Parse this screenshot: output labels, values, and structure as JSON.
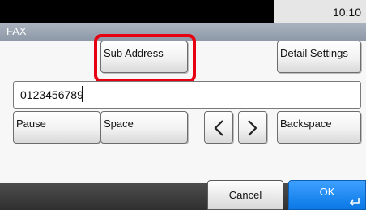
{
  "status": {
    "time": "10:10"
  },
  "header": {
    "title": "FAX"
  },
  "buttons": {
    "sub_address": "Sub Address",
    "detail_settings": "Detail Settings",
    "pause": "Pause",
    "space": "Space",
    "backspace": "Backspace"
  },
  "input": {
    "value": "0123456789"
  },
  "footer": {
    "cancel": "Cancel",
    "ok": "OK"
  },
  "colors": {
    "highlight": "#e60012",
    "ok": "#1a86f0",
    "header": "#9aa4b2"
  },
  "icons": [
    "chevron-left-icon",
    "chevron-right-icon",
    "enter-icon"
  ]
}
